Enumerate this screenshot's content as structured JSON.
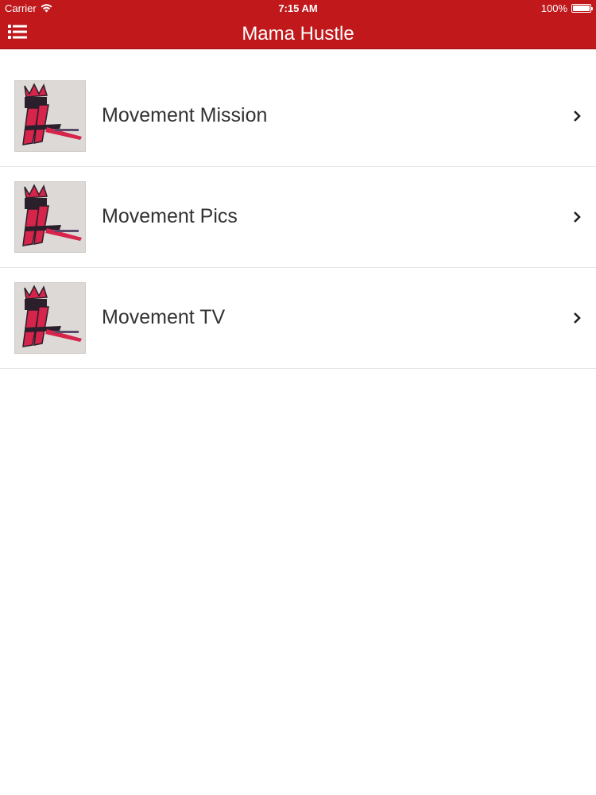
{
  "status_bar": {
    "carrier": "Carrier",
    "time": "7:15 AM",
    "battery": "100%",
    "battery_level": 1.0
  },
  "nav": {
    "title": "Mama Hustle",
    "menu_icon": "list-menu-icon"
  },
  "list": {
    "items": [
      {
        "label": "Movement Mission",
        "icon": "chevron-right-icon"
      },
      {
        "label": "Movement Pics",
        "icon": "chevron-right-icon"
      },
      {
        "label": "Movement TV",
        "icon": "chevron-right-icon"
      }
    ]
  },
  "colors": {
    "header_bg": "#c0181b",
    "text": "#333333",
    "divider": "#e6e6e6",
    "logo_red": "#d6244a",
    "logo_dark": "#2a1f2b"
  }
}
